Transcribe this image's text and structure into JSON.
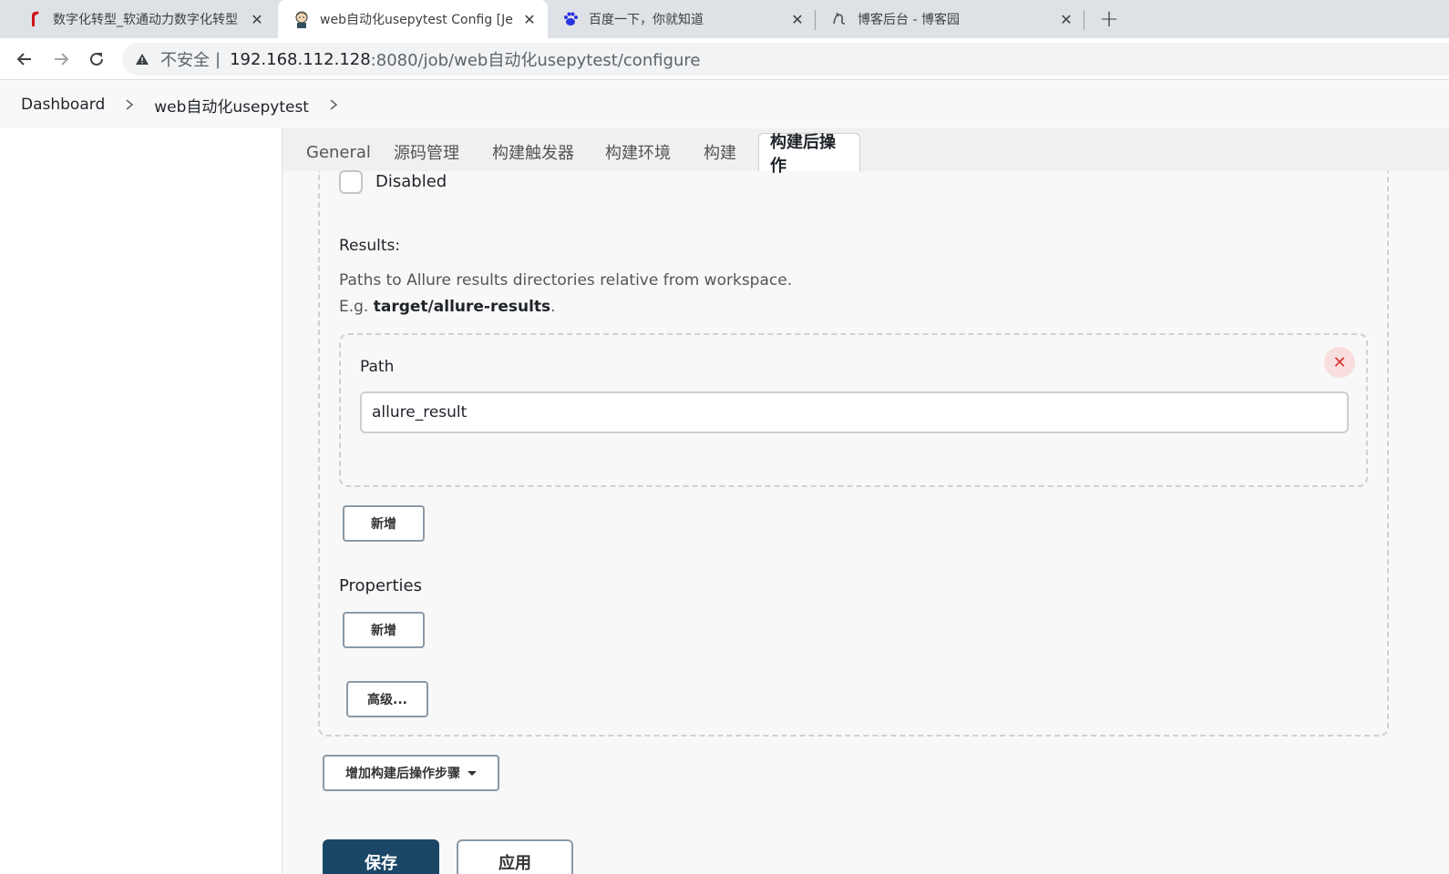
{
  "browser": {
    "tabs": [
      {
        "title": "数字化转型_软通动力数字化转型",
        "icon": "isoftstone-logo-icon"
      },
      {
        "title": "web自动化usepytest Config [Je",
        "icon": "jenkins-logo-icon"
      },
      {
        "title": "百度一下，你就知道",
        "icon": "baidu-paw-icon"
      },
      {
        "title": "博客后台 - 博客园",
        "icon": "cnblogs-logo-icon"
      }
    ],
    "active_tab": 1,
    "address": {
      "insecure_label": "不安全",
      "separator": "|",
      "host": "192.168.112.128",
      "path": ":8080/job/web自动化usepytest/configure"
    }
  },
  "breadcrumb": {
    "items": [
      "Dashboard",
      "web自动化usepytest"
    ]
  },
  "config": {
    "tabs": [
      "General",
      "源码管理",
      "构建触发器",
      "构建环境",
      "构建",
      "构建后操作"
    ],
    "active_tab": 5,
    "disabled_label": "Disabled",
    "results_label": "Results:",
    "results_help_1": "Paths to Allure results directories relative from workspace.",
    "results_help_2_prefix": "E.g. ",
    "results_help_2_bold": "target/allure-results",
    "results_help_2_suffix": ".",
    "path_label": "Path",
    "path_value": "allure_result",
    "add_button_1": "新增",
    "properties_label": "Properties",
    "add_button_2": "新增",
    "advanced_button": "高级...",
    "add_post_build_button": "增加构建后操作步骤",
    "save_button": "保存",
    "apply_button": "应用"
  },
  "colors": {
    "save_bg": "#1b4766",
    "delete_bg": "#f9dede",
    "delete_fg": "#dd3333"
  }
}
